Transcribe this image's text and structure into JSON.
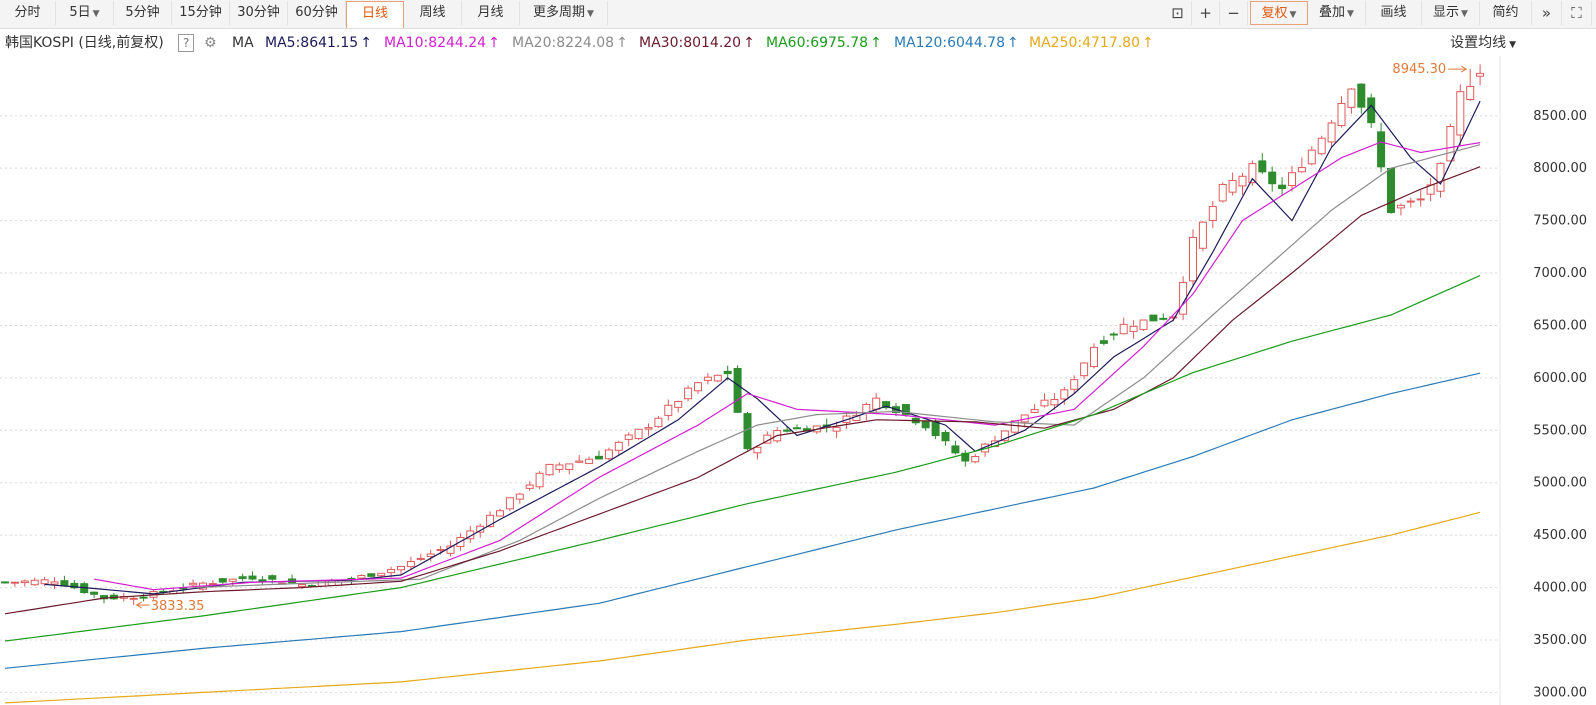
{
  "toolbar": {
    "periods": [
      {
        "label": "分时",
        "caret": false,
        "active": false
      },
      {
        "label": "5日",
        "caret": true,
        "active": false
      },
      {
        "label": "5分钟",
        "caret": false,
        "active": false
      },
      {
        "label": "15分钟",
        "caret": false,
        "active": false
      },
      {
        "label": "30分钟",
        "caret": false,
        "active": false
      },
      {
        "label": "60分钟",
        "caret": false,
        "active": false
      },
      {
        "label": "日线",
        "caret": false,
        "active": true
      },
      {
        "label": "周线",
        "caret": false,
        "active": false
      },
      {
        "label": "月线",
        "caret": false,
        "active": false
      },
      {
        "label": "更多周期",
        "caret": true,
        "active": false
      }
    ],
    "right_tools": [
      {
        "label": "复权",
        "caret": true,
        "accent": true
      },
      {
        "label": "叠加",
        "caret": true,
        "accent": false
      },
      {
        "label": "画线",
        "caret": false,
        "accent": false
      },
      {
        "label": "显示",
        "caret": true,
        "accent": false
      },
      {
        "label": "简约",
        "caret": false,
        "accent": false
      }
    ],
    "icons": {
      "lock": "⊡",
      "zoom_in": "+",
      "zoom_out": "−",
      "next": "»",
      "fullscreen": "⛶"
    }
  },
  "legend": {
    "instrument": "韩国KOSPI (日线,前复权)",
    "help": "?",
    "gear": "⚙",
    "ma_label": "MA",
    "items": [
      {
        "text": "MA5:8641.15",
        "arrow": "↑",
        "color": "#1a1a5c"
      },
      {
        "text": "MA10:8244.24",
        "arrow": "↑",
        "color": "#d21fd2"
      },
      {
        "text": "MA20:8224.08",
        "arrow": "↑",
        "color": "#8c8c8c"
      },
      {
        "text": "MA30:8014.20",
        "arrow": "↑",
        "color": "#6b1a2a"
      },
      {
        "text": "MA60:6975.78",
        "arrow": "↑",
        "color": "#1a9c1a"
      },
      {
        "text": "MA120:6044.78",
        "arrow": "↑",
        "color": "#2a7ab8"
      },
      {
        "text": "MA250:4717.80",
        "arrow": "↑",
        "color": "#e6a81a"
      }
    ],
    "setting_label": "设置均线"
  },
  "chart_data": {
    "type": "candlestick",
    "title": "韩国KOSPI (日线,前复权)",
    "y_ticks": [
      3000,
      3500,
      4000,
      4500,
      5000,
      5500,
      6000,
      6500,
      7000,
      7500,
      8000,
      8500
    ],
    "y_tick_labels": [
      "3000.00",
      "3500.00",
      "4000.00",
      "4500.00",
      "5000.00",
      "5500.00",
      "6000.00",
      "6500.00",
      "7000.00",
      "7500.00",
      "8000.00",
      "8500.00"
    ],
    "ylim": [
      2880,
      9070
    ],
    "high_label": "8945.30",
    "low_label": "3833.35",
    "high_value": 8945.3,
    "low_value": 3833.35,
    "high_index": 148,
    "low_index": 13,
    "up_color": "#e05a5a",
    "down_color": "#2e8b2e",
    "close_keypoints": [
      [
        0,
        4050
      ],
      [
        5,
        4070
      ],
      [
        10,
        3900
      ],
      [
        14,
        3920
      ],
      [
        20,
        4040
      ],
      [
        25,
        4100
      ],
      [
        30,
        4030
      ],
      [
        35,
        4080
      ],
      [
        40,
        4200
      ],
      [
        45,
        4400
      ],
      [
        50,
        4750
      ],
      [
        55,
        5150
      ],
      [
        60,
        5250
      ],
      [
        65,
        5550
      ],
      [
        70,
        5950
      ],
      [
        73,
        6050
      ],
      [
        75,
        5300
      ],
      [
        78,
        5500
      ],
      [
        84,
        5550
      ],
      [
        88,
        5800
      ],
      [
        93,
        5550
      ],
      [
        97,
        5200
      ],
      [
        103,
        5650
      ],
      [
        107,
        5860
      ],
      [
        110,
        6300
      ],
      [
        113,
        6500
      ],
      [
        118,
        6600
      ],
      [
        120,
        7300
      ],
      [
        123,
        7800
      ],
      [
        126,
        8000
      ],
      [
        129,
        7800
      ],
      [
        133,
        8300
      ],
      [
        136,
        8800
      ],
      [
        138,
        8400
      ],
      [
        140,
        7600
      ],
      [
        143,
        7700
      ],
      [
        145,
        8000
      ],
      [
        147,
        8700
      ],
      [
        149,
        8945
      ]
    ],
    "ma": [
      {
        "name": "MA5",
        "color": "#1a1a5c",
        "keypoints": [
          [
            4,
            4030
          ],
          [
            8,
            4000
          ],
          [
            15,
            3940
          ],
          [
            24,
            4050
          ],
          [
            35,
            4070
          ],
          [
            40,
            4120
          ],
          [
            50,
            4650
          ],
          [
            60,
            5150
          ],
          [
            68,
            5600
          ],
          [
            73,
            6000
          ],
          [
            76,
            5800
          ],
          [
            80,
            5450
          ],
          [
            85,
            5600
          ],
          [
            89,
            5730
          ],
          [
            95,
            5550
          ],
          [
            98,
            5300
          ],
          [
            103,
            5500
          ],
          [
            108,
            5850
          ],
          [
            112,
            6200
          ],
          [
            118,
            6550
          ],
          [
            122,
            7200
          ],
          [
            126,
            7900
          ],
          [
            130,
            7500
          ],
          [
            134,
            8200
          ],
          [
            138,
            8600
          ],
          [
            142,
            8100
          ],
          [
            145,
            7850
          ],
          [
            149,
            8640
          ]
        ]
      },
      {
        "name": "MA10",
        "color": "#d21fd2",
        "keypoints": [
          [
            9,
            4080
          ],
          [
            15,
            3980
          ],
          [
            25,
            4050
          ],
          [
            40,
            4090
          ],
          [
            50,
            4450
          ],
          [
            60,
            5050
          ],
          [
            70,
            5550
          ],
          [
            75,
            5850
          ],
          [
            80,
            5700
          ],
          [
            90,
            5650
          ],
          [
            100,
            5550
          ],
          [
            108,
            5700
          ],
          [
            115,
            6300
          ],
          [
            120,
            6800
          ],
          [
            125,
            7500
          ],
          [
            130,
            7800
          ],
          [
            135,
            8100
          ],
          [
            139,
            8250
          ],
          [
            143,
            8150
          ],
          [
            149,
            8244
          ]
        ]
      },
      {
        "name": "MA20",
        "color": "#8c8c8c",
        "keypoints": [
          [
            19,
            4000
          ],
          [
            30,
            4040
          ],
          [
            42,
            4080
          ],
          [
            52,
            4450
          ],
          [
            60,
            4850
          ],
          [
            70,
            5300
          ],
          [
            76,
            5550
          ],
          [
            82,
            5650
          ],
          [
            90,
            5680
          ],
          [
            100,
            5580
          ],
          [
            108,
            5550
          ],
          [
            115,
            6000
          ],
          [
            122,
            6600
          ],
          [
            128,
            7100
          ],
          [
            134,
            7600
          ],
          [
            140,
            8000
          ],
          [
            149,
            8224
          ]
        ]
      },
      {
        "name": "MA30",
        "color": "#6b1a2a",
        "keypoints": [
          [
            0,
            3750
          ],
          [
            10,
            3900
          ],
          [
            20,
            3960
          ],
          [
            30,
            4000
          ],
          [
            40,
            4060
          ],
          [
            50,
            4350
          ],
          [
            60,
            4700
          ],
          [
            70,
            5050
          ],
          [
            78,
            5450
          ],
          [
            88,
            5600
          ],
          [
            98,
            5580
          ],
          [
            105,
            5520
          ],
          [
            112,
            5700
          ],
          [
            118,
            6000
          ],
          [
            124,
            6550
          ],
          [
            130,
            7000
          ],
          [
            137,
            7550
          ],
          [
            143,
            7800
          ],
          [
            149,
            8014
          ]
        ]
      },
      {
        "name": "MA60",
        "color": "#1a9c1a",
        "keypoints": [
          [
            0,
            3490
          ],
          [
            20,
            3730
          ],
          [
            40,
            4000
          ],
          [
            60,
            4450
          ],
          [
            75,
            4800
          ],
          [
            90,
            5100
          ],
          [
            100,
            5350
          ],
          [
            110,
            5650
          ],
          [
            120,
            6050
          ],
          [
            130,
            6350
          ],
          [
            140,
            6600
          ],
          [
            149,
            6976
          ]
        ]
      },
      {
        "name": "MA120",
        "color": "#2a7ab8",
        "keypoints": [
          [
            0,
            3230
          ],
          [
            20,
            3420
          ],
          [
            40,
            3580
          ],
          [
            60,
            3850
          ],
          [
            75,
            4200
          ],
          [
            90,
            4550
          ],
          [
            100,
            4750
          ],
          [
            110,
            4950
          ],
          [
            120,
            5250
          ],
          [
            130,
            5600
          ],
          [
            140,
            5850
          ],
          [
            149,
            6045
          ]
        ]
      },
      {
        "name": "MA250",
        "color": "#e6a81a",
        "keypoints": [
          [
            0,
            2900
          ],
          [
            20,
            3000
          ],
          [
            40,
            3100
          ],
          [
            60,
            3300
          ],
          [
            75,
            3500
          ],
          [
            90,
            3650
          ],
          [
            100,
            3760
          ],
          [
            110,
            3900
          ],
          [
            120,
            4100
          ],
          [
            130,
            4300
          ],
          [
            140,
            4500
          ],
          [
            149,
            4718
          ]
        ]
      }
    ]
  }
}
